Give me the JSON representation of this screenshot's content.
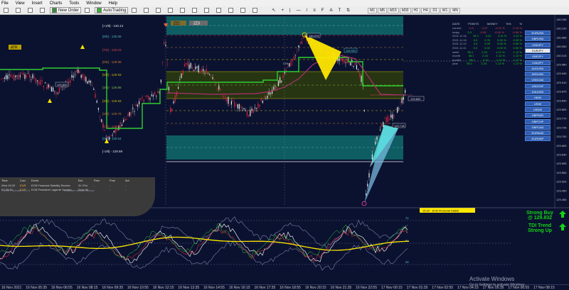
{
  "menu": [
    "File",
    "View",
    "Insert",
    "Charts",
    "Tools",
    "Window",
    "Help"
  ],
  "toolbar": {
    "new_order": "New Order",
    "auto_trading": "AutoTrading",
    "timeframes": [
      "M1",
      "M5",
      "M15",
      "M30",
      "H1",
      "H4",
      "D1",
      "W1",
      "MN"
    ]
  },
  "levels": {
    "top": "[+1/8] - 130.13",
    "l8": "[8/8] - 130.08",
    "l7": "[7/8] - 130.03",
    "l6": "[6/8] - 129.98",
    "l5": "[5/8] - 129.93",
    "l4": "[4/8] - 129.88",
    "l3": "[3/8] - 129.83",
    "l2": "[2/8] - 129.78",
    "l1": "[1/8] - 129.69",
    "l0": "[0/8] - 129.64",
    "bottom": "[-1/8] - 129.59"
  },
  "markers": {
    "atr": "ATR",
    "price_left": "129.829",
    "price_top": "130.079",
    "price_mid": "129.932",
    "price_right": "129.832",
    "price_right2": "129.718",
    "label_zz1": "ZZ1",
    "label_zz2": "ZZ3",
    "label_chl": "CHL"
  },
  "price_axis": [
    "130.155",
    "130.120",
    "130.085",
    "130.050",
    "130.015",
    "129.980",
    "129.945",
    "129.910",
    "129.875",
    "129.840",
    "129.805",
    "129.770",
    "129.735",
    "129.700",
    "129.665",
    "129.630",
    "129.595",
    "129.560",
    "129.525",
    "129.490",
    "129.455"
  ],
  "stats": {
    "headers": [
      "DATE",
      "POINTS",
      "MONEY",
      "%%",
      "%"
    ],
    "rows": [
      [
        "current",
        "-0.0",
        "-0.37",
        "-0.19 %",
        "-0.19 %"
      ],
      [
        "today",
        "3.0",
        "-0.36",
        "-0.06 %",
        "-0.06 %"
      ],
      [
        "2021.11.16",
        "51.1",
        "4.22",
        "2.11 %",
        "2.11 %"
      ],
      [
        "2021.11.15",
        "5.0",
        "0.76",
        "0.39 %",
        "0.39 %"
      ],
      [
        "2021.11.12",
        "0.0",
        "0.00",
        "0.00 %",
        "0.00 %"
      ],
      [
        "2021.11.11",
        "0.0",
        "0.00",
        "0.00 %",
        "0.00 %"
      ],
      [
        "week",
        "56.1",
        "2.24",
        "1.12 %",
        "1.12 %"
      ],
      [
        "month",
        "56.1",
        "2.24",
        "1.12 %",
        "1.12 %"
      ],
      [
        "quarter",
        "56.1",
        "2.24",
        "1.12 %",
        "1.12 %"
      ],
      [
        "year",
        "56.1",
        "2.24",
        "1.12 %",
        "1.12 %"
      ]
    ]
  },
  "symbols": [
    "EURUSD",
    "GBPUSD",
    "USDJPY",
    "EURJPY",
    "GBPJPY",
    "CADJPY",
    "AUDUSD",
    "NZDUSD",
    "USDCAD",
    "USDCHF",
    "XAUUSD",
    "HK50",
    "US30",
    "US500",
    "GBPNZD",
    "GBPCHF",
    "GBPCAD",
    "EURAUD",
    "EURGBP"
  ],
  "active_symbol": "EURJPY",
  "news": {
    "headers": [
      "Time",
      "Curr.",
      "Event",
      "Est.",
      "Prev",
      "Fcst",
      "Act"
    ],
    "rows": [
      [
        "Wed 15:20",
        "EUR",
        "ECB Financial Stability Review",
        "2h 37m",
        "-",
        "-",
        "-"
      ],
      [
        "Fri 09:30",
        "EUR",
        "ECB President Lagarde Speaks",
        "2day 3h",
        "-",
        "-",
        "-"
      ]
    ],
    "footer_left": "Event Forecast v1.2.3",
    "footer_right": "Nuvolex News Factory"
  },
  "news_event_label": "15:20 - ECB Financial Stabili",
  "indicator": {
    "title": "TDI Alerts 56.1100 44.8257 51.9420 54.6160 48.4439 33.0000",
    "level_top": "70",
    "level_mid": "50",
    "level_bot": "33",
    "axis_top": "77.6311",
    "axis_bot": "24.4201"
  },
  "signal": {
    "line1": "Strong Buy",
    "line2": "@ 129.832",
    "line3": "TDI Trend",
    "line4": "Strong Up"
  },
  "time_axis": [
    "16 Nov 2021",
    "16 Nov 05:35",
    "16 Nov 06:55",
    "16 Nov 08:15",
    "16 Nov 09:35",
    "16 Nov 10:55",
    "16 Nov 12:15",
    "16 Nov 13:35",
    "16 Nov 14:55",
    "16 Nov 16:15",
    "16 Nov 17:35",
    "16 Nov 18:55",
    "16 Nov 20:15",
    "16 Nov 21:35",
    "16 Nov 22:55",
    "17 Nov 00:15",
    "17 Nov 01:35",
    "17 Nov 02:55",
    "17 Nov 04:15",
    "17 Nov 05:35",
    "17 Nov 06:55",
    "17 Nov 08:15"
  ],
  "windows": {
    "line1": "Activate Windows",
    "line2": "Go to Settings to activate Windows."
  },
  "colors": {
    "bg": "#0b1230",
    "bull": "#e8e8e8",
    "bear": "#d4273b",
    "green_line": "#2fcf2f",
    "teal_zone": "#0f6b6b",
    "olive_zone": "#2a3a10",
    "yellow": "#ffe700",
    "signal": "#16d414"
  }
}
